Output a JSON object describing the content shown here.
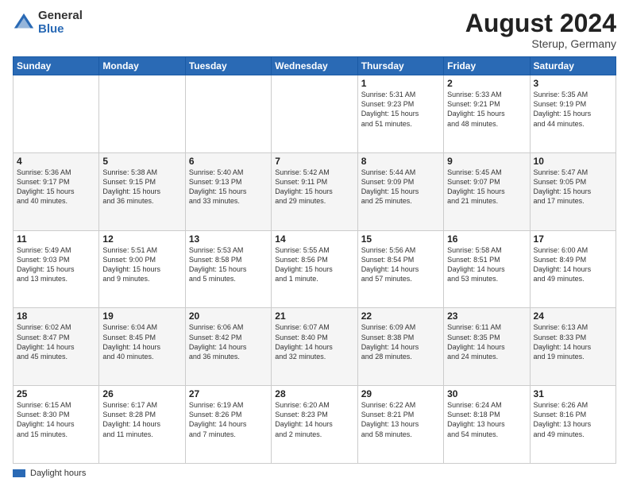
{
  "header": {
    "logo_general": "General",
    "logo_blue": "Blue",
    "month_title": "August 2024",
    "location": "Sterup, Germany"
  },
  "days_of_week": [
    "Sunday",
    "Monday",
    "Tuesday",
    "Wednesday",
    "Thursday",
    "Friday",
    "Saturday"
  ],
  "legend": {
    "label": "Daylight hours"
  },
  "weeks": [
    {
      "days": [
        {
          "num": "",
          "info": ""
        },
        {
          "num": "",
          "info": ""
        },
        {
          "num": "",
          "info": ""
        },
        {
          "num": "",
          "info": ""
        },
        {
          "num": "1",
          "info": "Sunrise: 5:31 AM\nSunset: 9:23 PM\nDaylight: 15 hours\nand 51 minutes."
        },
        {
          "num": "2",
          "info": "Sunrise: 5:33 AM\nSunset: 9:21 PM\nDaylight: 15 hours\nand 48 minutes."
        },
        {
          "num": "3",
          "info": "Sunrise: 5:35 AM\nSunset: 9:19 PM\nDaylight: 15 hours\nand 44 minutes."
        }
      ]
    },
    {
      "days": [
        {
          "num": "4",
          "info": "Sunrise: 5:36 AM\nSunset: 9:17 PM\nDaylight: 15 hours\nand 40 minutes."
        },
        {
          "num": "5",
          "info": "Sunrise: 5:38 AM\nSunset: 9:15 PM\nDaylight: 15 hours\nand 36 minutes."
        },
        {
          "num": "6",
          "info": "Sunrise: 5:40 AM\nSunset: 9:13 PM\nDaylight: 15 hours\nand 33 minutes."
        },
        {
          "num": "7",
          "info": "Sunrise: 5:42 AM\nSunset: 9:11 PM\nDaylight: 15 hours\nand 29 minutes."
        },
        {
          "num": "8",
          "info": "Sunrise: 5:44 AM\nSunset: 9:09 PM\nDaylight: 15 hours\nand 25 minutes."
        },
        {
          "num": "9",
          "info": "Sunrise: 5:45 AM\nSunset: 9:07 PM\nDaylight: 15 hours\nand 21 minutes."
        },
        {
          "num": "10",
          "info": "Sunrise: 5:47 AM\nSunset: 9:05 PM\nDaylight: 15 hours\nand 17 minutes."
        }
      ]
    },
    {
      "days": [
        {
          "num": "11",
          "info": "Sunrise: 5:49 AM\nSunset: 9:03 PM\nDaylight: 15 hours\nand 13 minutes."
        },
        {
          "num": "12",
          "info": "Sunrise: 5:51 AM\nSunset: 9:00 PM\nDaylight: 15 hours\nand 9 minutes."
        },
        {
          "num": "13",
          "info": "Sunrise: 5:53 AM\nSunset: 8:58 PM\nDaylight: 15 hours\nand 5 minutes."
        },
        {
          "num": "14",
          "info": "Sunrise: 5:55 AM\nSunset: 8:56 PM\nDaylight: 15 hours\nand 1 minute."
        },
        {
          "num": "15",
          "info": "Sunrise: 5:56 AM\nSunset: 8:54 PM\nDaylight: 14 hours\nand 57 minutes."
        },
        {
          "num": "16",
          "info": "Sunrise: 5:58 AM\nSunset: 8:51 PM\nDaylight: 14 hours\nand 53 minutes."
        },
        {
          "num": "17",
          "info": "Sunrise: 6:00 AM\nSunset: 8:49 PM\nDaylight: 14 hours\nand 49 minutes."
        }
      ]
    },
    {
      "days": [
        {
          "num": "18",
          "info": "Sunrise: 6:02 AM\nSunset: 8:47 PM\nDaylight: 14 hours\nand 45 minutes."
        },
        {
          "num": "19",
          "info": "Sunrise: 6:04 AM\nSunset: 8:45 PM\nDaylight: 14 hours\nand 40 minutes."
        },
        {
          "num": "20",
          "info": "Sunrise: 6:06 AM\nSunset: 8:42 PM\nDaylight: 14 hours\nand 36 minutes."
        },
        {
          "num": "21",
          "info": "Sunrise: 6:07 AM\nSunset: 8:40 PM\nDaylight: 14 hours\nand 32 minutes."
        },
        {
          "num": "22",
          "info": "Sunrise: 6:09 AM\nSunset: 8:38 PM\nDaylight: 14 hours\nand 28 minutes."
        },
        {
          "num": "23",
          "info": "Sunrise: 6:11 AM\nSunset: 8:35 PM\nDaylight: 14 hours\nand 24 minutes."
        },
        {
          "num": "24",
          "info": "Sunrise: 6:13 AM\nSunset: 8:33 PM\nDaylight: 14 hours\nand 19 minutes."
        }
      ]
    },
    {
      "days": [
        {
          "num": "25",
          "info": "Sunrise: 6:15 AM\nSunset: 8:30 PM\nDaylight: 14 hours\nand 15 minutes."
        },
        {
          "num": "26",
          "info": "Sunrise: 6:17 AM\nSunset: 8:28 PM\nDaylight: 14 hours\nand 11 minutes."
        },
        {
          "num": "27",
          "info": "Sunrise: 6:19 AM\nSunset: 8:26 PM\nDaylight: 14 hours\nand 7 minutes."
        },
        {
          "num": "28",
          "info": "Sunrise: 6:20 AM\nSunset: 8:23 PM\nDaylight: 14 hours\nand 2 minutes."
        },
        {
          "num": "29",
          "info": "Sunrise: 6:22 AM\nSunset: 8:21 PM\nDaylight: 13 hours\nand 58 minutes."
        },
        {
          "num": "30",
          "info": "Sunrise: 6:24 AM\nSunset: 8:18 PM\nDaylight: 13 hours\nand 54 minutes."
        },
        {
          "num": "31",
          "info": "Sunrise: 6:26 AM\nSunset: 8:16 PM\nDaylight: 13 hours\nand 49 minutes."
        }
      ]
    }
  ]
}
